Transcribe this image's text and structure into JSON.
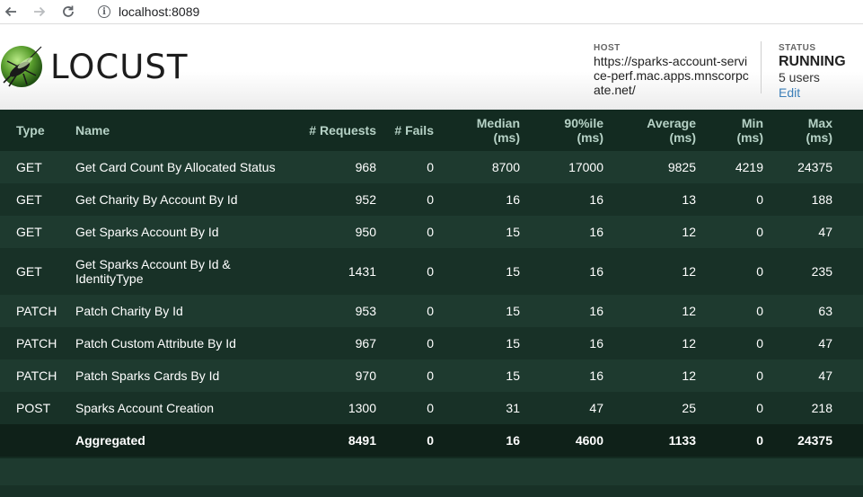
{
  "browser": {
    "url": "localhost:8089"
  },
  "app": {
    "logo_text": "LOCUST"
  },
  "host": {
    "label": "HOST",
    "value": "https://sparks-account-service-perf.mac.apps.mnscorpcate.net/"
  },
  "status": {
    "label": "STATUS",
    "value": "RUNNING",
    "users": "5 users",
    "edit_label": "Edit"
  },
  "table": {
    "headers": {
      "type": "Type",
      "name": "Name",
      "requests": "# Requests",
      "fails": "# Fails",
      "median_1": "Median",
      "median_2": "(ms)",
      "p90_1": "90%ile",
      "p90_2": "(ms)",
      "avg_1": "Average",
      "avg_2": "(ms)",
      "min_1": "Min",
      "min_2": "(ms)",
      "max_1": "Max",
      "max_2": "(ms)"
    },
    "rows": [
      {
        "type": "GET",
        "name": "Get Card Count By Allocated Status",
        "requests": "968",
        "fails": "0",
        "median": "8700",
        "p90": "17000",
        "avg": "9825",
        "min": "4219",
        "max": "24375"
      },
      {
        "type": "GET",
        "name": "Get Charity By Account By Id",
        "requests": "952",
        "fails": "0",
        "median": "16",
        "p90": "16",
        "avg": "13",
        "min": "0",
        "max": "188"
      },
      {
        "type": "GET",
        "name": "Get Sparks Account By Id",
        "requests": "950",
        "fails": "0",
        "median": "15",
        "p90": "16",
        "avg": "12",
        "min": "0",
        "max": "47"
      },
      {
        "type": "GET",
        "name": "Get Sparks Account By Id & IdentityType",
        "requests": "1431",
        "fails": "0",
        "median": "15",
        "p90": "16",
        "avg": "12",
        "min": "0",
        "max": "235"
      },
      {
        "type": "PATCH",
        "name": "Patch Charity By Id",
        "requests": "953",
        "fails": "0",
        "median": "15",
        "p90": "16",
        "avg": "12",
        "min": "0",
        "max": "63"
      },
      {
        "type": "PATCH",
        "name": "Patch Custom Attribute By Id",
        "requests": "967",
        "fails": "0",
        "median": "15",
        "p90": "16",
        "avg": "12",
        "min": "0",
        "max": "47"
      },
      {
        "type": "PATCH",
        "name": "Patch Sparks Cards By Id",
        "requests": "970",
        "fails": "0",
        "median": "15",
        "p90": "16",
        "avg": "12",
        "min": "0",
        "max": "47"
      },
      {
        "type": "POST",
        "name": "Sparks Account Creation",
        "requests": "1300",
        "fails": "0",
        "median": "31",
        "p90": "47",
        "avg": "25",
        "min": "0",
        "max": "218"
      }
    ],
    "aggregated": {
      "type": "",
      "name": "Aggregated",
      "requests": "8491",
      "fails": "0",
      "median": "16",
      "p90": "4600",
      "avg": "1133",
      "min": "0",
      "max": "24375"
    }
  }
}
